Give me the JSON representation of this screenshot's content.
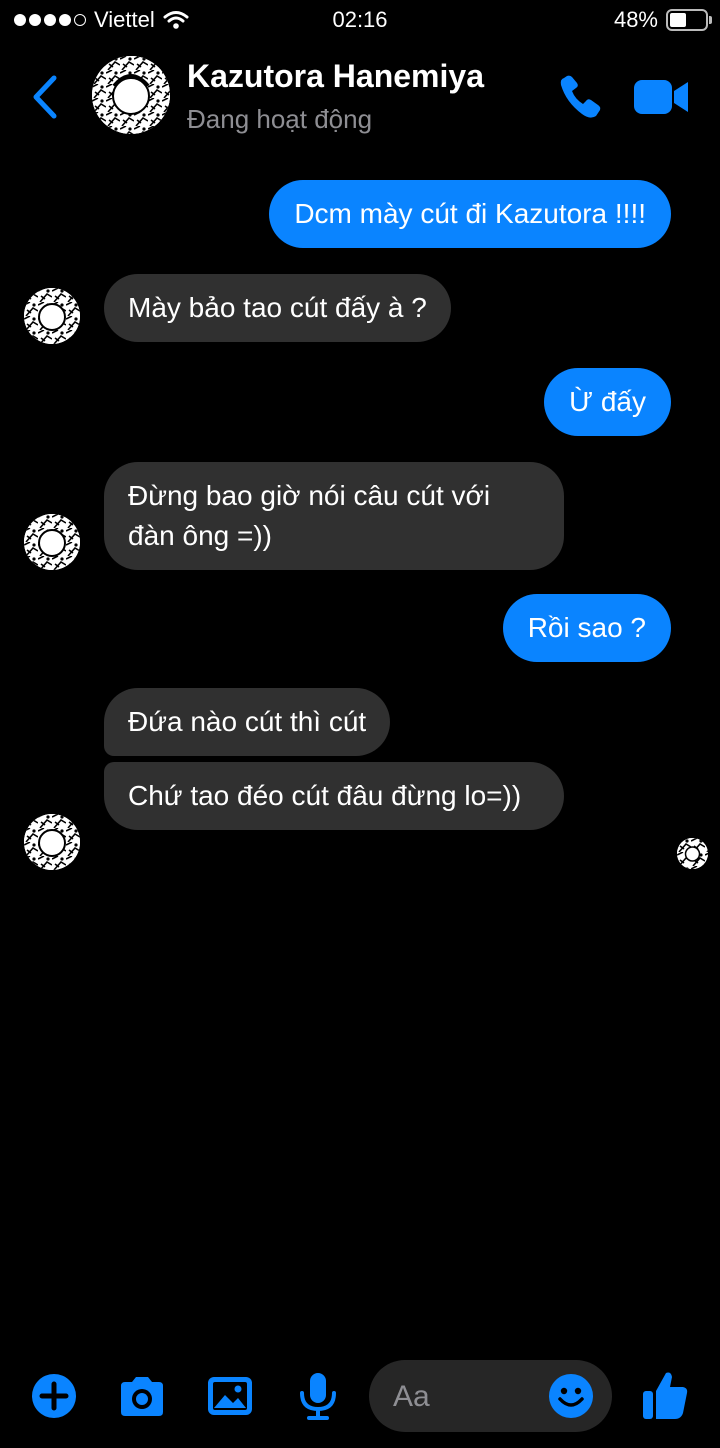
{
  "status_bar": {
    "carrier": "Viettel",
    "time": "02:16",
    "battery_percent": "48%",
    "battery_level": 0.48
  },
  "header": {
    "contact_name": "Kazutora Hanemiya",
    "contact_status": "Đang hoạt động"
  },
  "messages": [
    {
      "direction": "out",
      "text": "Dcm mày cút đi Kazutora !!!!"
    },
    {
      "direction": "in",
      "text": "Mày bảo tao cút đấy à ?"
    },
    {
      "direction": "out",
      "text": "Ừ đấy"
    },
    {
      "direction": "in",
      "text": "Đừng bao giờ nói câu cút với đàn ông =))"
    },
    {
      "direction": "out",
      "text": "Rồi sao ?"
    },
    {
      "direction": "in",
      "text": "Đứa nào cút thì cút"
    },
    {
      "direction": "in",
      "text": "Chứ tao đéo cút đâu đừng lo=))"
    }
  ],
  "composer": {
    "placeholder": "Aa"
  },
  "colors": {
    "accent": "#0a84ff",
    "incoming_bubble": "#303030",
    "background": "#000000",
    "secondary_text": "#8e8e93"
  },
  "icons": {
    "back": "chevron-left-icon",
    "call": "phone-icon",
    "video": "video-camera-icon",
    "add": "plus-circle-icon",
    "camera": "camera-icon",
    "gallery": "image-icon",
    "mic": "microphone-icon",
    "emoji": "smiley-icon",
    "like": "thumbs-up-icon"
  }
}
